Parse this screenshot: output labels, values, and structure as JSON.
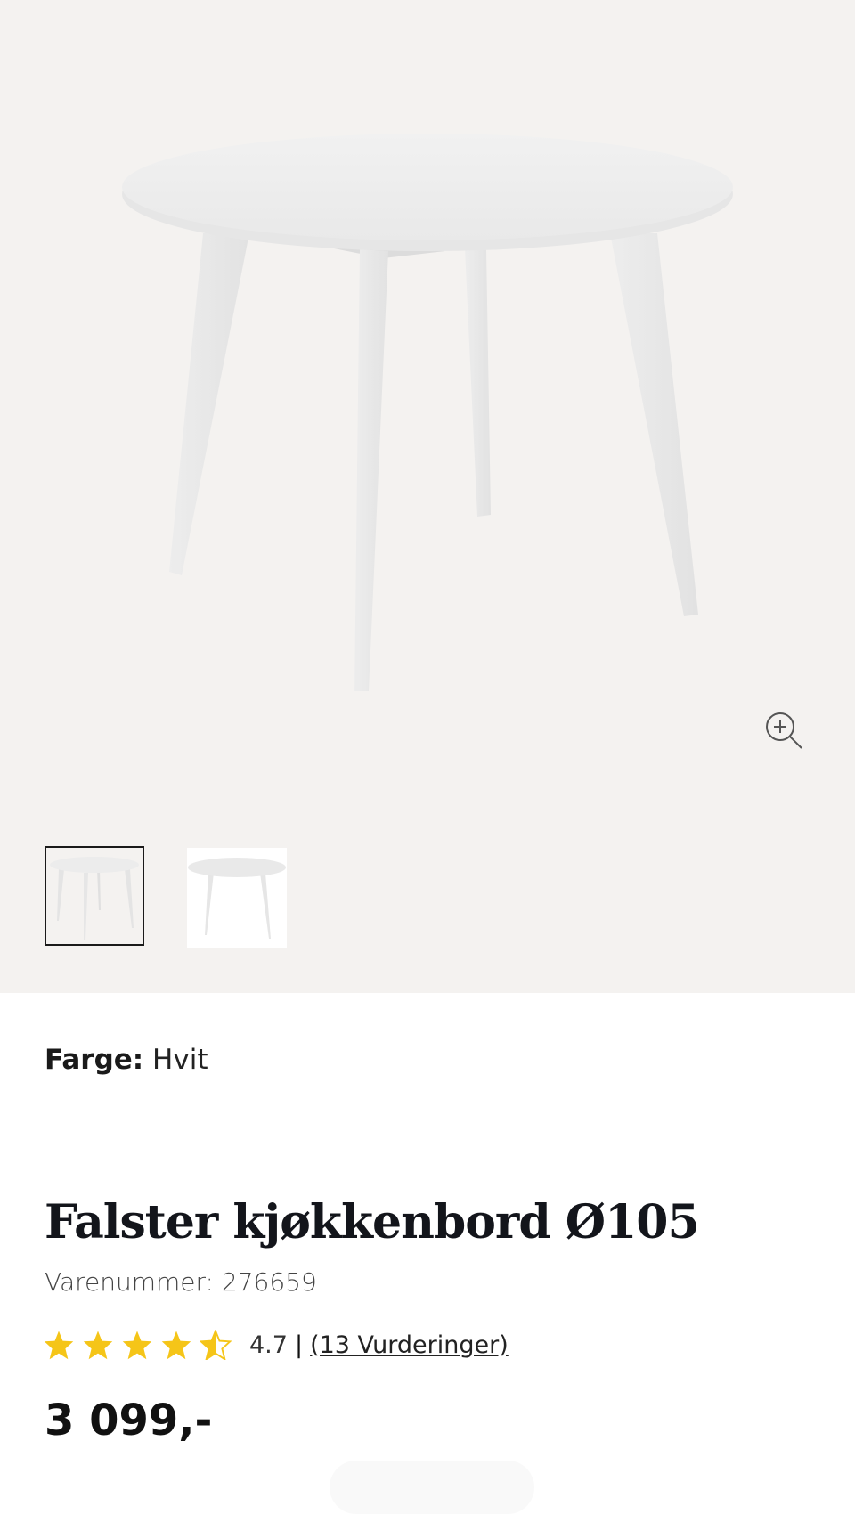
{
  "gallery": {
    "zoom_icon": "zoom-in-icon",
    "thumbnails": [
      {
        "label": "table-front-view",
        "selected": true
      },
      {
        "label": "table-side-view",
        "selected": false
      }
    ]
  },
  "product": {
    "color_label": "Farge:",
    "color_value": "Hvit",
    "title": "Falster kjøkkenbord Ø105",
    "sku": "Varenummer: 276659",
    "rating_value": 4.7,
    "rating_text": "4.7",
    "rating_separator": "|",
    "reviews_text": "(13 Vurderinger)",
    "price": "3 099,-"
  },
  "colors": {
    "gallery_bg": "#f4f2f0",
    "star": "#f5c518",
    "title": "#13151b"
  }
}
